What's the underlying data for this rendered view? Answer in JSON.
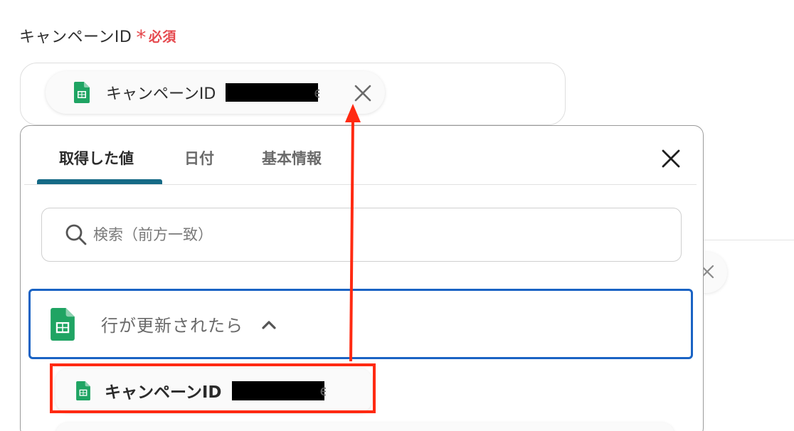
{
  "field": {
    "label": "キャンペーンID",
    "required_mark": "*",
    "required_text": "必須",
    "selected_chip": {
      "label": "キャンペーンID",
      "tail": "e",
      "icon": "google-sheets-icon"
    }
  },
  "panel": {
    "tabs": [
      {
        "label": "取得した値",
        "active": true
      },
      {
        "label": "日付",
        "active": false
      },
      {
        "label": "基本情報",
        "active": false
      }
    ],
    "search": {
      "placeholder": "検索（前方一致）"
    },
    "group": {
      "label": "行が更新されたら",
      "icon": "google-sheets-icon",
      "expanded": true
    },
    "items": [
      {
        "label": "キャンペーンID",
        "tail": "e",
        "icon": "google-sheets-icon"
      }
    ]
  },
  "colors": {
    "required": "#e5484d",
    "tab_accent": "#156a86",
    "group_border": "#1a63c4",
    "annotation": "#ff2a12",
    "sheets_green": "#1fa463"
  }
}
